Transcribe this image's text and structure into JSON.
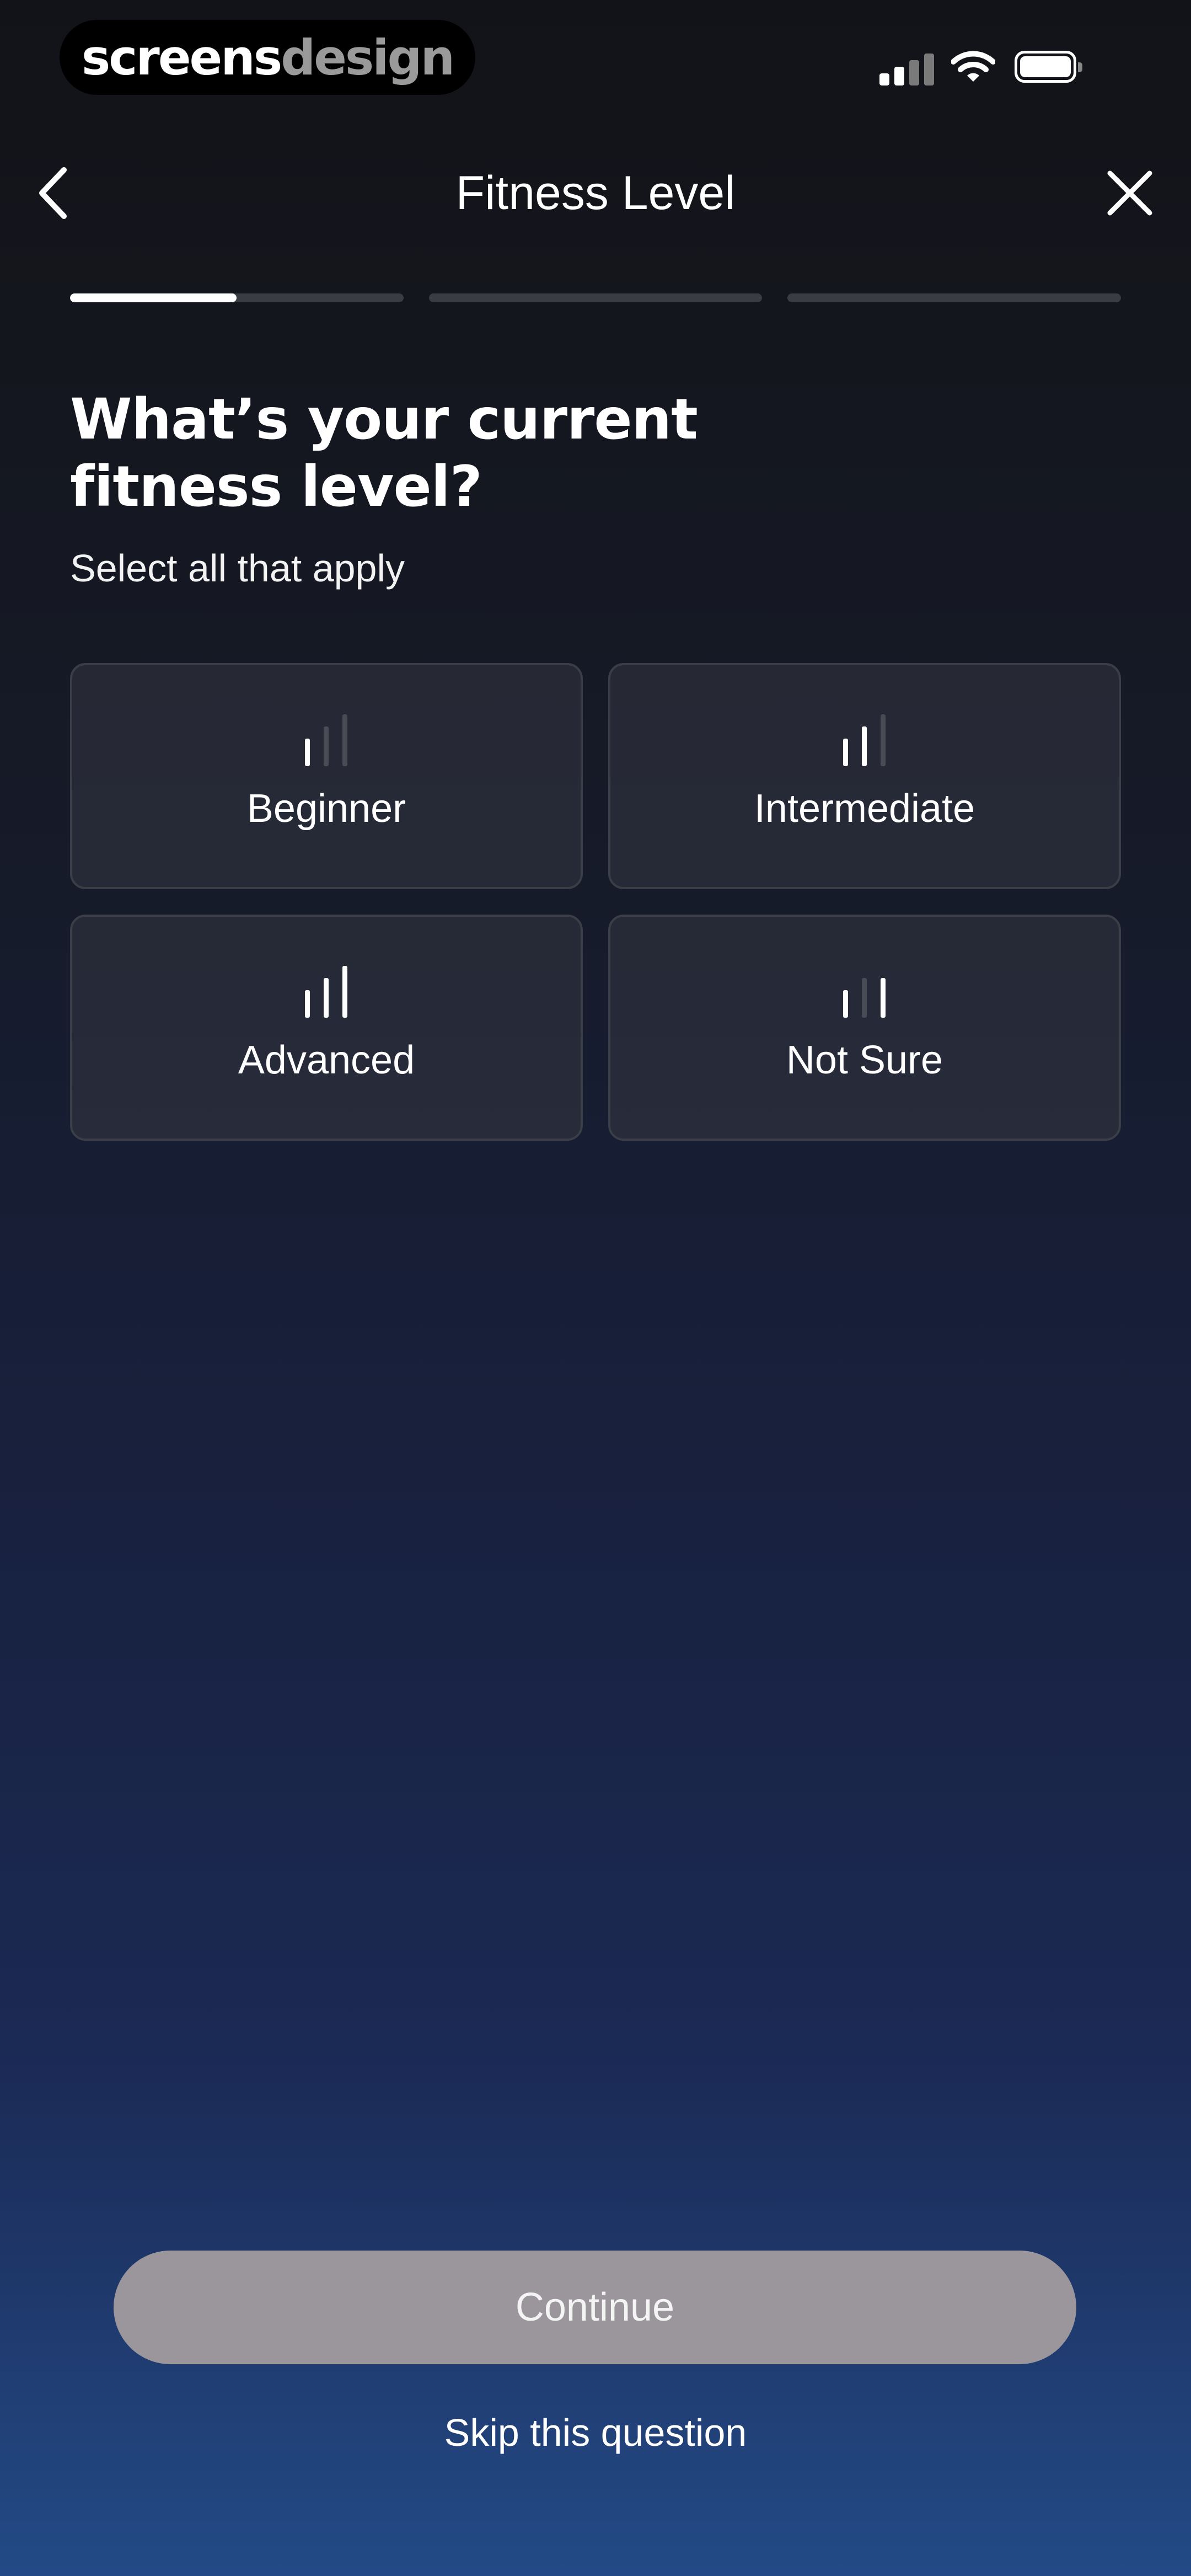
{
  "watermark": {
    "part1": "screens",
    "part2": "design"
  },
  "status_bar": {
    "icons": [
      "signal-icon",
      "wifi-icon",
      "battery-icon"
    ]
  },
  "nav": {
    "title": "Fitness Level",
    "back_icon": "chevron-left-icon",
    "close_icon": "close-icon"
  },
  "progress": {
    "steps": 3,
    "current_step": 1,
    "current_step_fill": 0.5
  },
  "question": {
    "title_line1": "What’s your current",
    "title_line2": "fitness level?",
    "subtitle": "Select all that apply"
  },
  "options": [
    {
      "label": "Beginner",
      "icon": "signal-bars-low-icon",
      "level": 1
    },
    {
      "label": "Intermediate",
      "icon": "signal-bars-medium-icon",
      "level": 2
    },
    {
      "label": "Advanced",
      "icon": "signal-bars-high-icon",
      "level": 3
    },
    {
      "label": "Not Sure",
      "icon": "signal-bars-unknown-icon",
      "level": null
    }
  ],
  "continue_label": "Continue",
  "skip_label": "Skip this question",
  "colors": {
    "active": "#ffffff",
    "inactive": "#4a4c55",
    "continue_bg": "#9a969c"
  }
}
